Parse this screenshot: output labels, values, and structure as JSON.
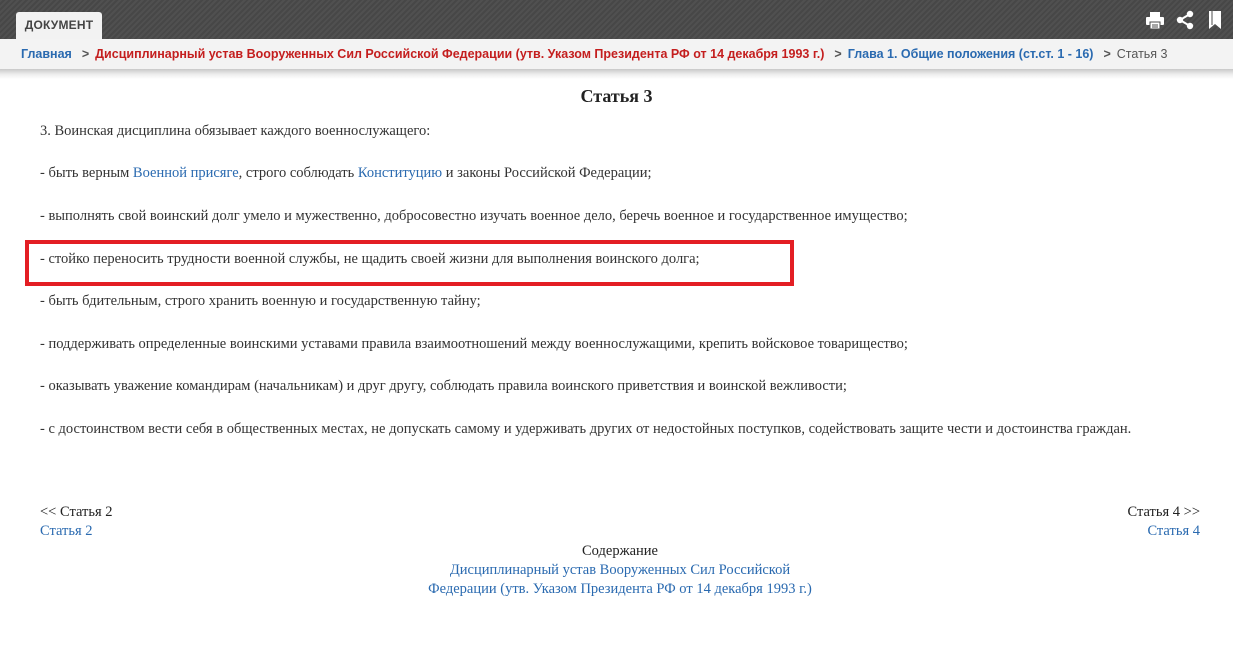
{
  "tab": {
    "label": "ДОКУМЕНТ"
  },
  "toolbar_icons": [
    "print-icon",
    "share-icon",
    "bookmark-icon"
  ],
  "breadcrumb": {
    "home": "Главная",
    "document": "Дисциплинарный устав Вооруженных Сил Российской Федерации (утв. Указом Президента РФ от 14 декабря 1993 г.)",
    "chapter": "Глава 1. Общие положения (ст.ст. 1 - 16)",
    "current": "Статья 3",
    "separator": ">"
  },
  "article": {
    "title": "Статья 3",
    "intro": "3. Воинская дисциплина обязывает каждого военнослужащего:",
    "p1": {
      "before": "- быть верным ",
      "link1": "Военной присяге",
      "middle": ", строго соблюдать ",
      "link2": "Конституцию",
      "after": " и законы Российской Федерации;"
    },
    "items": [
      "- выполнять свой воинский долг умело и мужественно, добросовестно изучать военное дело, беречь военное и государственное имущество;",
      "- стойко переносить трудности военной службы, не щадить своей жизни для выполнения воинского долга;",
      "- быть бдительным, строго хранить военную и государственную тайну;",
      "- поддерживать определенные воинскими уставами правила взаимоотношений между военнослужащими, крепить войсковое товарищество;",
      "- оказывать уважение командирам (начальникам) и друг другу, соблюдать правила воинского приветствия и воинской вежливости;",
      "- с достоинством вести себя в общественных местах, не допускать самому и удерживать других от недостойных поступков, содействовать защите чести и достоинства граждан."
    ]
  },
  "navigation": {
    "prev_label": "<< Статья 2",
    "prev_link": "Статья 2",
    "next_label": "Статья 4 >>",
    "next_link": "Статья 4"
  },
  "toc": {
    "label": "Содержание",
    "link": "Дисциплинарный устав Вооруженных Сил Российской Федерации (утв. Указом Президента РФ от 14 декабря 1993 г.)"
  },
  "colors": {
    "link": "#2a6ab0",
    "breadcrumb_document": "#c41e1e",
    "highlight": "#e31e24",
    "topbar": "#4d4d4d"
  }
}
